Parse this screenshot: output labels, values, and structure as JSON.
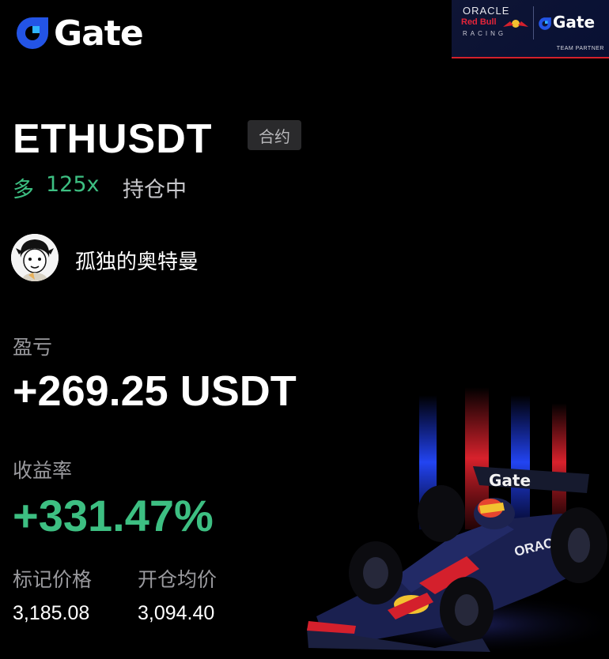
{
  "brand": {
    "name": "Gate",
    "logo_color": "#2354e6"
  },
  "sponsor": {
    "line1": "ORACLE",
    "line2": "Red Bull",
    "line3": "RACING",
    "partner_brand": "Gate",
    "partner_label": "TEAM PARTNER"
  },
  "position": {
    "symbol": "ETHUSDT",
    "contract_tag": "合约",
    "side": "多",
    "leverage": "125x",
    "status": "持仓中"
  },
  "user": {
    "name": "孤独的奥特曼"
  },
  "pnl": {
    "label": "盈亏",
    "value": "+269.25 USDT"
  },
  "roi": {
    "label": "收益率",
    "value": "+331.47%"
  },
  "prices": {
    "mark_label": "标记价格",
    "mark_value": "3,185.08",
    "entry_label": "开仓均价",
    "entry_value": "3,094.40"
  },
  "car_wing_text": "Gate",
  "car_sidepod_text": "ORACLE",
  "colors": {
    "background": "#000000",
    "accent_green": "#3dbf82",
    "muted_text": "#9a9a9e",
    "tag_bg": "#2a2a2c",
    "redbull_red": "#e5253a",
    "navy": "#0f1535"
  }
}
